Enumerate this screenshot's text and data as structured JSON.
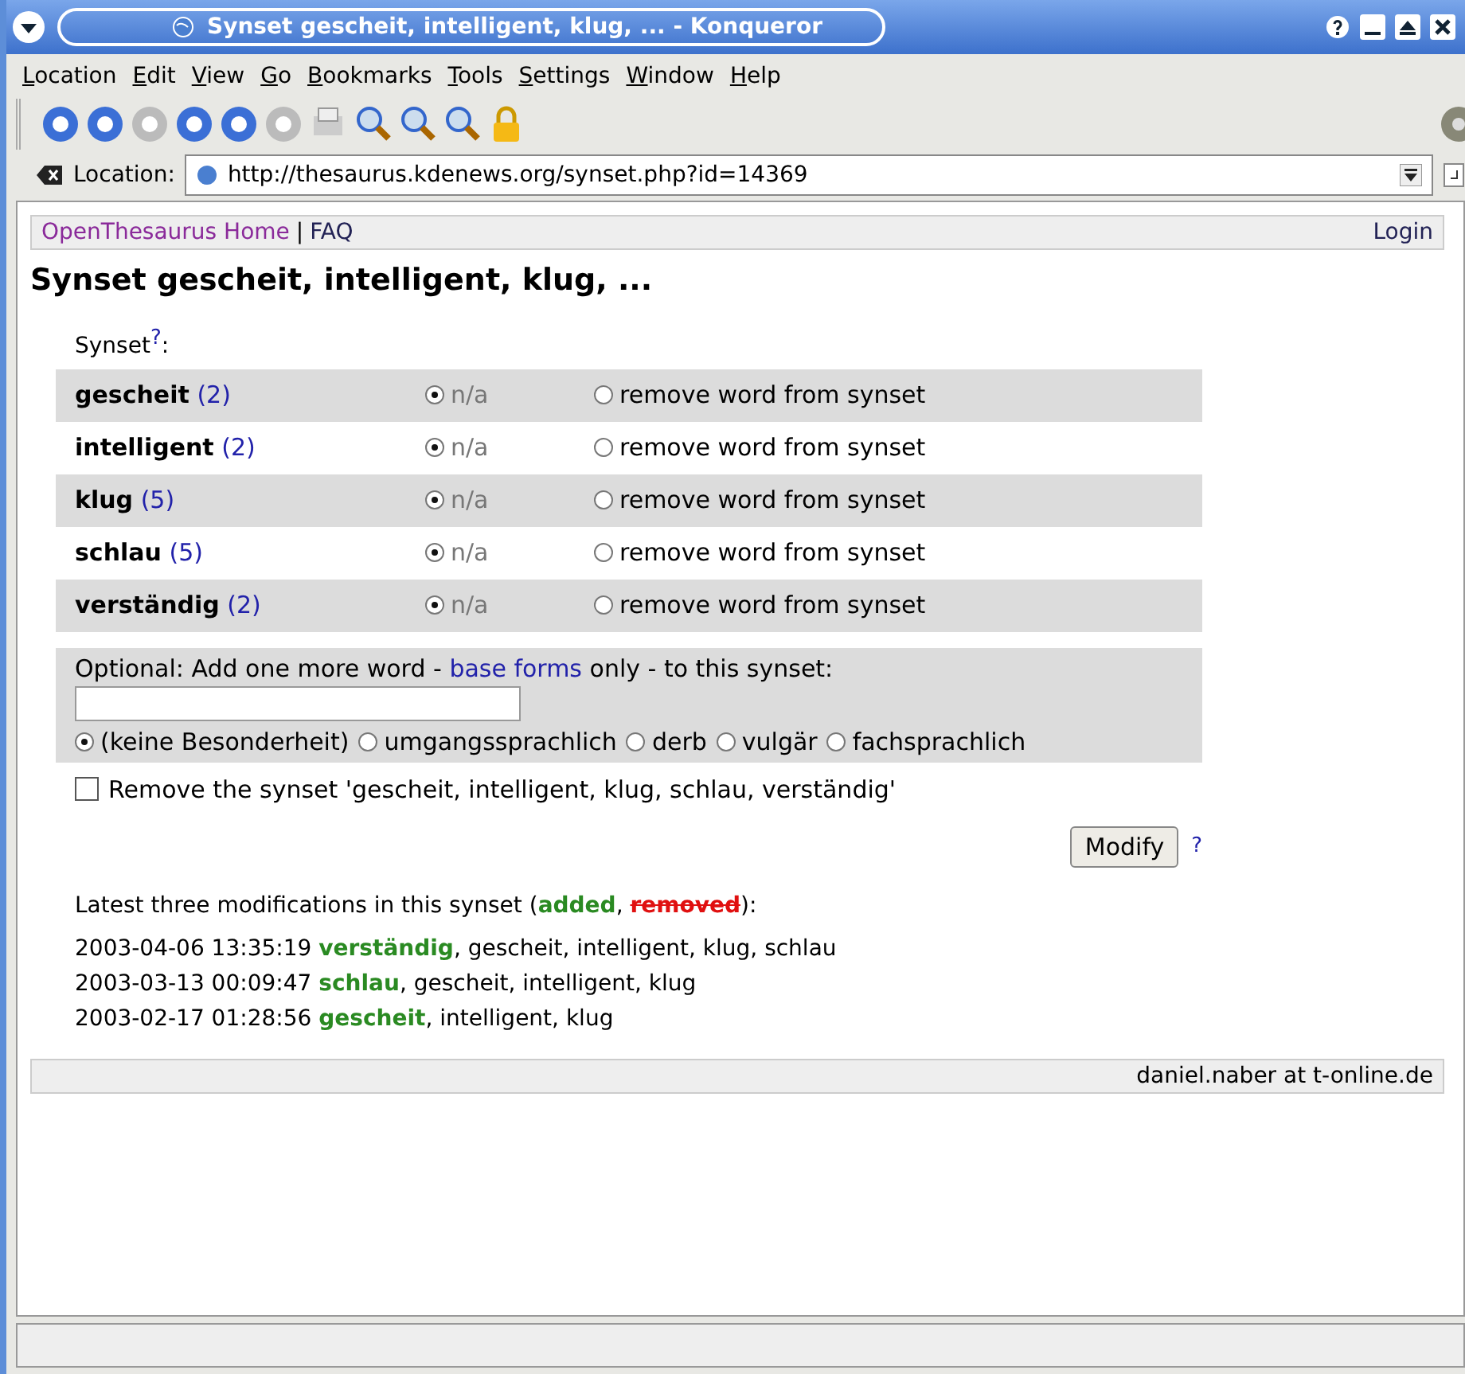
{
  "window": {
    "title": "Synset gescheit, intelligent, klug, ... - Konqueror"
  },
  "menu": [
    "Location",
    "Edit",
    "View",
    "Go",
    "Bookmarks",
    "Tools",
    "Settings",
    "Window",
    "Help"
  ],
  "location_bar": {
    "label": "Location:",
    "url": "http://thesaurus.kdenews.org/synset.php?id=14369"
  },
  "nav": {
    "links": [
      "OpenThesaurus Home",
      "FAQ"
    ],
    "separator": "|",
    "login": "Login"
  },
  "heading": "Synset gescheit, intelligent, klug, ...",
  "synset_label": {
    "text": "Synset",
    "help": "?",
    "colon": ":"
  },
  "words": [
    {
      "word": "gescheit",
      "count": "(2)",
      "options": [
        {
          "label": "n/a",
          "selected": true
        },
        {
          "label": "remove word from synset",
          "selected": false
        }
      ]
    },
    {
      "word": "intelligent",
      "count": "(2)",
      "options": [
        {
          "label": "n/a",
          "selected": true
        },
        {
          "label": "remove word from synset",
          "selected": false
        }
      ]
    },
    {
      "word": "klug",
      "count": "(5)",
      "options": [
        {
          "label": "n/a",
          "selected": true
        },
        {
          "label": "remove word from synset",
          "selected": false
        }
      ]
    },
    {
      "word": "schlau",
      "count": "(5)",
      "options": [
        {
          "label": "n/a",
          "selected": true
        },
        {
          "label": "remove word from synset",
          "selected": false
        }
      ]
    },
    {
      "word": "verständig",
      "count": "(2)",
      "options": [
        {
          "label": "n/a",
          "selected": true
        },
        {
          "label": "remove word from synset",
          "selected": false
        }
      ]
    }
  ],
  "add_word": {
    "before": "Optional: Add one more word - ",
    "link": "base forms",
    "after": " only - to this synset:",
    "registers": [
      {
        "label": "(keine Besonderheit)",
        "selected": true
      },
      {
        "label": "umgangssprachlich",
        "selected": false
      },
      {
        "label": "derb",
        "selected": false
      },
      {
        "label": "vulgär",
        "selected": false
      },
      {
        "label": "fachsprachlich",
        "selected": false
      }
    ]
  },
  "remove_synset": {
    "label": "Remove the synset 'gescheit, intelligent, klug, schlau, verständig'",
    "checked": false
  },
  "modify": {
    "button": "Modify",
    "help": "?"
  },
  "modifications": {
    "before": "Latest three modifications in this synset (",
    "added": "added",
    "comma": ", ",
    "removed": "removed",
    "after": "):",
    "rows": [
      {
        "time": "2003-04-06 13:35:19",
        "added": "verständig",
        "rest": ", gescheit, intelligent, klug, schlau"
      },
      {
        "time": "2003-03-13 00:09:47",
        "added": "schlau",
        "rest": ", gescheit, intelligent, klug"
      },
      {
        "time": "2003-02-17 01:28:56",
        "added": "gescheit",
        "rest": ", intelligent, klug"
      }
    ]
  },
  "footer": "daniel.naber at t-online.de"
}
